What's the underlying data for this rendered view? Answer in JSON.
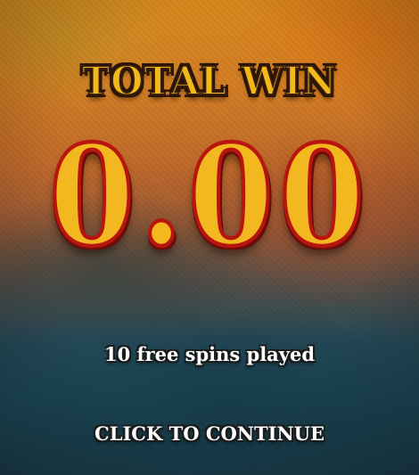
{
  "win_screen": {
    "title": "TOTAL WIN",
    "amount": "0.00",
    "spins_played": "10 free spins played",
    "continue_label": "CLICK TO CONTINUE"
  },
  "colors": {
    "title_fill": "#f2b91c",
    "amount_fill": "#f3b820",
    "amount_outline": "#b8150f",
    "text_white": "#ffffff",
    "background_top": "#d98a1e",
    "background_bottom": "#1c3f4d"
  }
}
